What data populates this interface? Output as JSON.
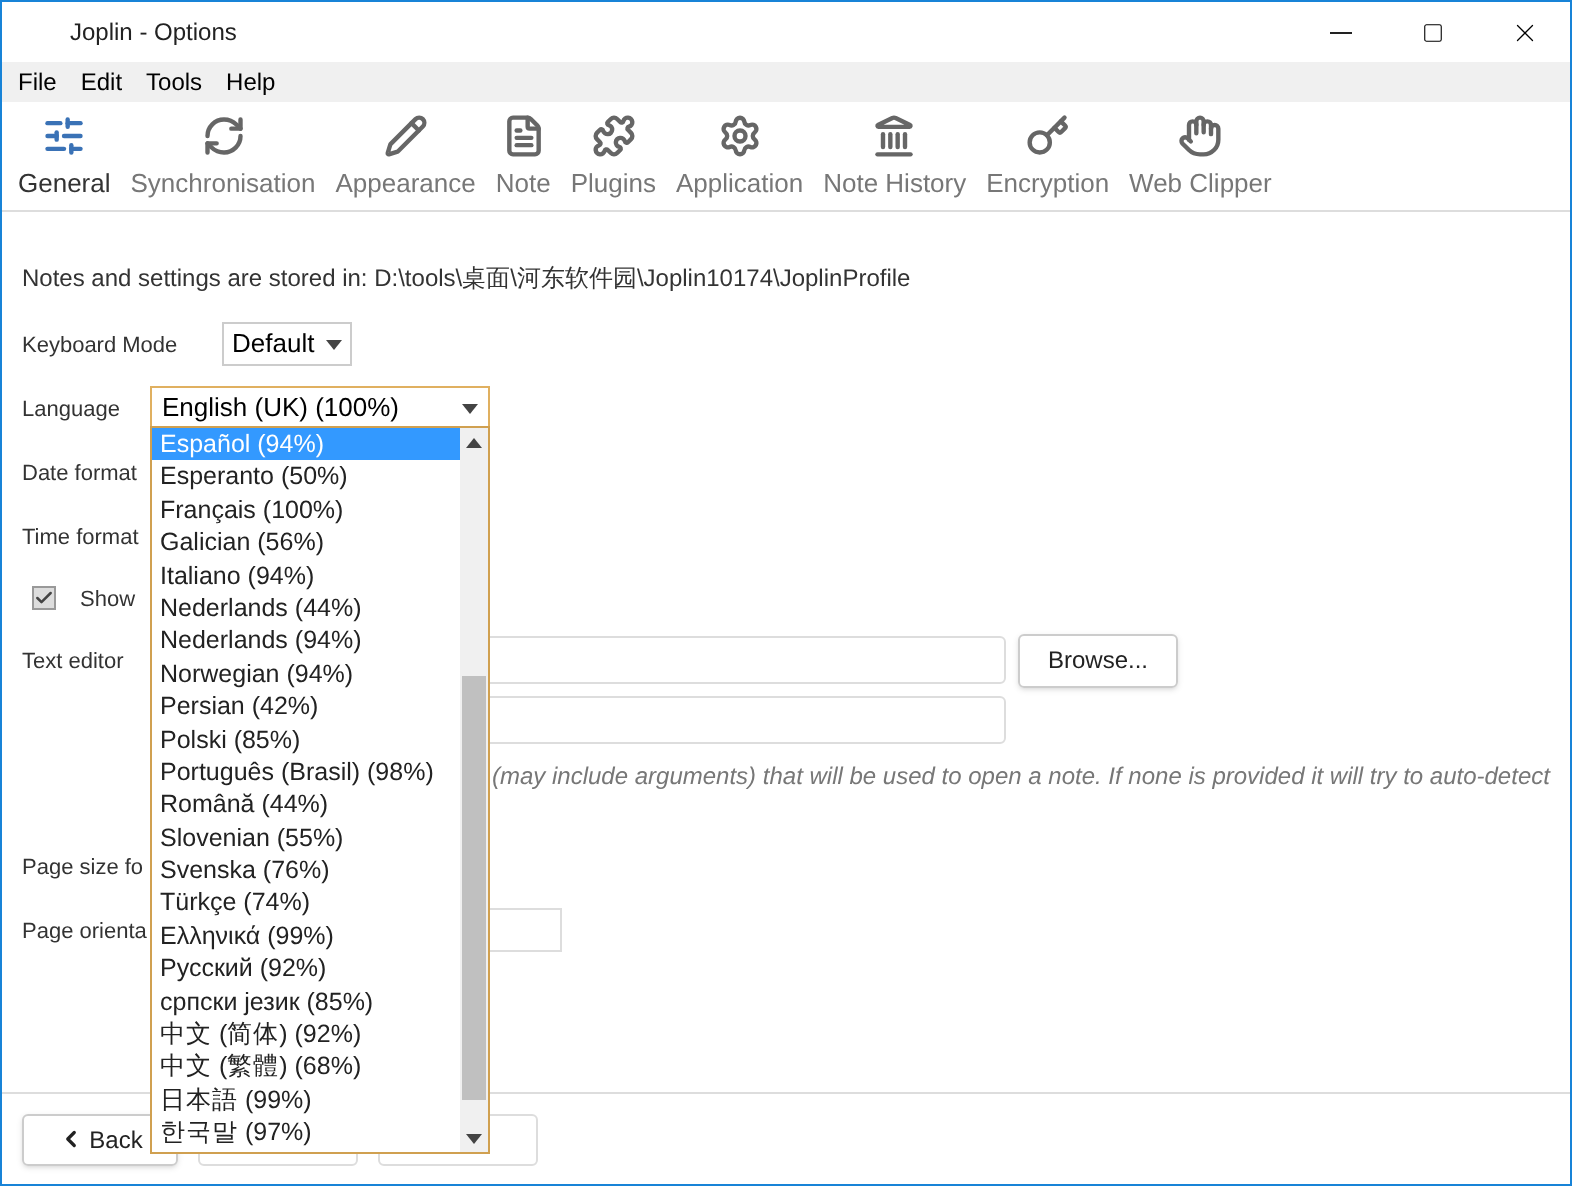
{
  "window": {
    "title": "Joplin - Options"
  },
  "menu": [
    "File",
    "Edit",
    "Tools",
    "Help"
  ],
  "tabs": [
    {
      "label": "General",
      "selected": true
    },
    {
      "label": "Synchronisation",
      "selected": false
    },
    {
      "label": "Appearance",
      "selected": false
    },
    {
      "label": "Note",
      "selected": false
    },
    {
      "label": "Plugins",
      "selected": false
    },
    {
      "label": "Application",
      "selected": false
    },
    {
      "label": "Note History",
      "selected": false
    },
    {
      "label": "Encryption",
      "selected": false
    },
    {
      "label": "Web Clipper",
      "selected": false
    }
  ],
  "settings": {
    "storage_note": "Notes and settings are stored in: D:\\tools\\桌面\\河东软件园\\Joplin10174\\JoplinProfile",
    "keyboard_mode": {
      "label": "Keyboard Mode",
      "value": "Default"
    },
    "language": {
      "label": "Language",
      "value": "English (UK) (100%)"
    },
    "date_format": {
      "label": "Date format"
    },
    "time_format": {
      "label": "Time format"
    },
    "show_option": {
      "label": "Show",
      "checked": true
    },
    "text_editor": {
      "label": "Text editor",
      "browse_button": "Browse..."
    },
    "editor_help": "(may include arguments) that will be used to open a note. If none is provided it will try to auto-detect",
    "page_size": {
      "label": "Page size fo"
    },
    "page_orientation": {
      "label": "Page orienta"
    }
  },
  "language_options": [
    {
      "label": "Español (94%)",
      "selected": true
    },
    {
      "label": "Esperanto (50%)",
      "selected": false
    },
    {
      "label": "Français (100%)",
      "selected": false
    },
    {
      "label": "Galician (56%)",
      "selected": false
    },
    {
      "label": "Italiano (94%)",
      "selected": false
    },
    {
      "label": "Nederlands (44%)",
      "selected": false
    },
    {
      "label": "Nederlands (94%)",
      "selected": false
    },
    {
      "label": "Norwegian (94%)",
      "selected": false
    },
    {
      "label": "Persian (42%)",
      "selected": false
    },
    {
      "label": "Polski (85%)",
      "selected": false
    },
    {
      "label": "Português (Brasil) (98%)",
      "selected": false
    },
    {
      "label": "Română (44%)",
      "selected": false
    },
    {
      "label": "Slovenian (55%)",
      "selected": false
    },
    {
      "label": "Svenska (76%)",
      "selected": false
    },
    {
      "label": "Türkçe (74%)",
      "selected": false
    },
    {
      "label": "Ελληνικά (99%)",
      "selected": false
    },
    {
      "label": "Русский (92%)",
      "selected": false
    },
    {
      "label": "српски језик (85%)",
      "selected": false
    },
    {
      "label": "中文 (简体) (92%)",
      "selected": false
    },
    {
      "label": "中文 (繁體) (68%)",
      "selected": false
    },
    {
      "label": "日本語 (99%)",
      "selected": false
    },
    {
      "label": "한국말 (97%)",
      "selected": false
    }
  ],
  "footer": {
    "back_button": "Back"
  }
}
